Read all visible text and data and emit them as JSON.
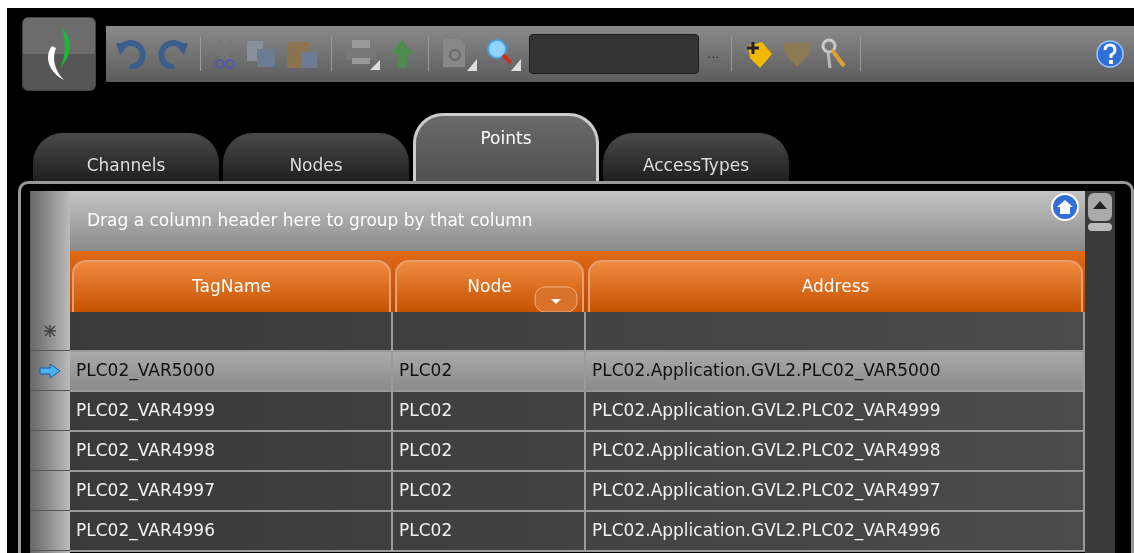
{
  "toolbar": {
    "more_label": "..."
  },
  "tabs": [
    {
      "label": "Channels",
      "selected": false
    },
    {
      "label": "Nodes",
      "selected": false
    },
    {
      "label": "Points",
      "selected": true
    },
    {
      "label": "AccessTypes",
      "selected": false
    }
  ],
  "grid": {
    "group_panel": "Drag a column header here to group by that column",
    "columns": [
      "TagName",
      "Node",
      "Address"
    ],
    "rows": [
      {
        "selected": true,
        "cells": [
          "PLC02_VAR5000",
          "PLC02",
          "PLC02.Application.GVL2.PLC02_VAR5000"
        ]
      },
      {
        "selected": false,
        "cells": [
          "PLC02_VAR4999",
          "PLC02",
          "PLC02.Application.GVL2.PLC02_VAR4999"
        ]
      },
      {
        "selected": false,
        "cells": [
          "PLC02_VAR4998",
          "PLC02",
          "PLC02.Application.GVL2.PLC02_VAR4998"
        ]
      },
      {
        "selected": false,
        "cells": [
          "PLC02_VAR4997",
          "PLC02",
          "PLC02.Application.GVL2.PLC02_VAR4997"
        ]
      },
      {
        "selected": false,
        "cells": [
          "PLC02_VAR4996",
          "PLC02",
          "PLC02.Application.GVL2.PLC02_VAR4996"
        ]
      }
    ]
  }
}
